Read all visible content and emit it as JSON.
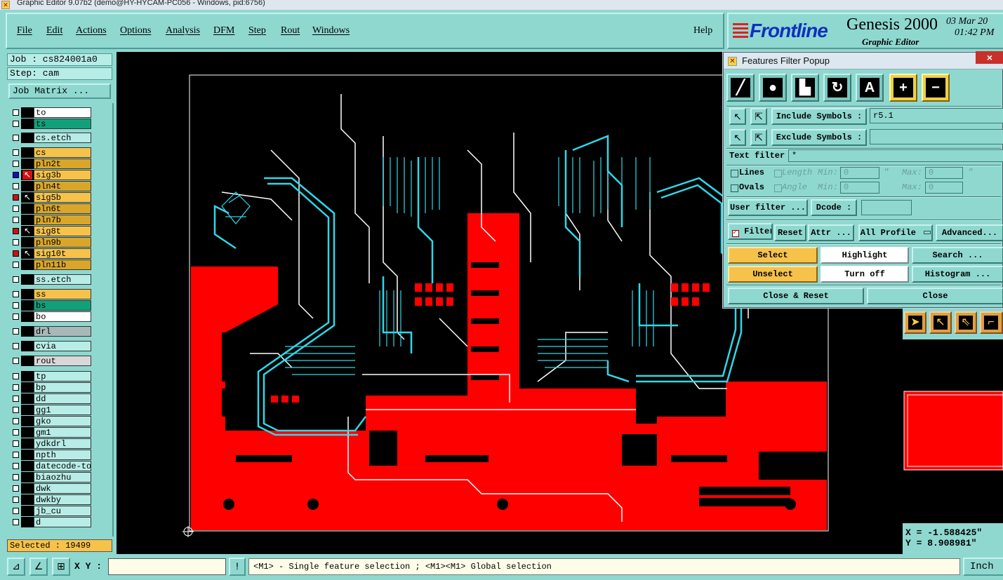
{
  "window": {
    "title": "Graphic Editor 9.07b2 (demo@HY-HYCAM-PC056 - Windows, pid:6756)"
  },
  "menu": {
    "items": [
      "File",
      "Edit",
      "Actions",
      "Options",
      "Analysis",
      "DFM",
      "Step",
      "Rout",
      "Windows"
    ],
    "help": "Help"
  },
  "brand": {
    "logo": "Frontline",
    "product": "Genesis 2000",
    "subtitle": "Graphic Editor",
    "date": "03 Mar 20",
    "time": "01:42 PM"
  },
  "job": {
    "job_label": "Job : cs824001a0",
    "step_label": "Step: cam",
    "matrix_button": "Job Matrix ..."
  },
  "layers": [
    {
      "name": "to",
      "color": "#ffffff",
      "state": "off"
    },
    {
      "name": "ts",
      "color": "#12a07a",
      "state": "off"
    },
    {
      "name": "cs.etch",
      "color": "#b8ece6",
      "state": "off"
    },
    {
      "name": "cs",
      "color": "#f6c24a",
      "state": "off"
    },
    {
      "name": "pln2t",
      "color": "#d9a62a",
      "state": "off"
    },
    {
      "name": "sig3b",
      "color": "#f6c24a",
      "state": "work"
    },
    {
      "name": "pln4t",
      "color": "#d9a62a",
      "state": "off"
    },
    {
      "name": "sig5b",
      "color": "#f6c24a",
      "state": "affected"
    },
    {
      "name": "pln6t",
      "color": "#d9a62a",
      "state": "off"
    },
    {
      "name": "pln7b",
      "color": "#d9a62a",
      "state": "off"
    },
    {
      "name": "sig8t",
      "color": "#f6c24a",
      "state": "affected"
    },
    {
      "name": "pln9b",
      "color": "#d9a62a",
      "state": "off"
    },
    {
      "name": "sig10t",
      "color": "#f6c24a",
      "state": "affected"
    },
    {
      "name": "pln11b",
      "color": "#d9a62a",
      "state": "off"
    },
    {
      "name": "ss.etch",
      "color": "#b8ece6",
      "state": "off"
    },
    {
      "name": "ss",
      "color": "#f6c24a",
      "state": "off"
    },
    {
      "name": "bs",
      "color": "#12a07a",
      "state": "off"
    },
    {
      "name": "bo",
      "color": "#ffffff",
      "state": "off"
    },
    {
      "name": "drl",
      "color": "#a8b8b8",
      "state": "off"
    },
    {
      "name": "cvia",
      "color": "#b8ece6",
      "state": "off"
    },
    {
      "name": "rout",
      "color": "#d8d8d8",
      "state": "off"
    },
    {
      "name": "tp",
      "color": "#b8ece6",
      "state": "off"
    },
    {
      "name": "bp",
      "color": "#b8ece6",
      "state": "off"
    },
    {
      "name": "dd",
      "color": "#b8ece6",
      "state": "off"
    },
    {
      "name": "gg1",
      "color": "#b8ece6",
      "state": "off"
    },
    {
      "name": "gko",
      "color": "#b8ece6",
      "state": "off"
    },
    {
      "name": "gm1",
      "color": "#b8ece6",
      "state": "off"
    },
    {
      "name": "ydkdrl",
      "color": "#b8ece6",
      "state": "off"
    },
    {
      "name": "npth",
      "color": "#b8ece6",
      "state": "off"
    },
    {
      "name": "datecode-to",
      "color": "#b8ece6",
      "state": "off"
    },
    {
      "name": "biaozhu",
      "color": "#b8ece6",
      "state": "off"
    },
    {
      "name": "dwk",
      "color": "#b8ece6",
      "state": "off"
    },
    {
      "name": "dwkby",
      "color": "#b8ece6",
      "state": "off"
    },
    {
      "name": "jb_cu",
      "color": "#b8ece6",
      "state": "off"
    },
    {
      "name": "d",
      "color": "#b8ece6",
      "state": "off"
    }
  ],
  "status": {
    "selected": "Selected : 19499",
    "xy_label": "X Y :",
    "xy_value": "",
    "hint": "<M1> - Single feature selection ; <M1><M1> Global selection",
    "units": "Inch",
    "x_coord": "X = -1.588425\"",
    "y_coord": "Y = 8.908981\""
  },
  "popup": {
    "title": "Features Filter Popup",
    "close_glyph": "×",
    "feature_types": [
      "line",
      "pad",
      "surface",
      "arc",
      "text",
      "positive",
      "negative"
    ],
    "include_symbols_label": "Include Symbols :",
    "include_symbols_value": "r5.1",
    "exclude_symbols_label": "Exclude Symbols :",
    "exclude_symbols_value": "",
    "text_filter_label": "Text filter",
    "text_filter_value": "*",
    "lines_label": "Lines",
    "ovals_label": "Ovals",
    "length_label": "Length",
    "angle_label": "Angle",
    "min_label": "Min:",
    "max_label": "Max:",
    "zero": "0",
    "quote": "\"",
    "user_filter": "User filter ...",
    "dcode_label": "Dcode :",
    "dcode_value": "",
    "filter_label": "Filter",
    "reset": "Reset",
    "attr": "Attr ...",
    "profile": "All Profile",
    "advanced": "Advanced...",
    "select": "Select",
    "highlight": "Highlight",
    "search": "Search ...",
    "unselect": "Unselect",
    "turn_off": "Turn off",
    "histogram": "Histogram ...",
    "close_reset": "Close & Reset",
    "close": "Close"
  },
  "colors": {
    "panel": "#8fd8d0",
    "copper": "#ff0000",
    "trace_selected": "#2fd8e8",
    "trace": "#ffffff",
    "highlight_orange": "#f6c24a"
  }
}
